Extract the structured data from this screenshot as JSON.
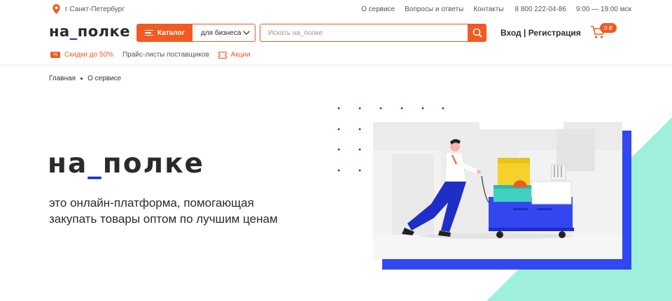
{
  "topbar": {
    "city": "г Санкт-Петербург",
    "links": [
      "О сервисе",
      "Вопросы и ответы",
      "Контакты"
    ],
    "phone": "8 800 222-04-86",
    "hours": "9:00 — 19:00 мск"
  },
  "header": {
    "logo_left": "на",
    "logo_underscore": "_",
    "logo_right": "полке",
    "catalog_label": "Каталог",
    "business_select": "для бизнеса",
    "search_placeholder": "Искать на_полке",
    "login_label": "Вход | Регистрация",
    "cart_total": "0 ₽"
  },
  "subnav": {
    "discount_badge": "%",
    "discount_label": "Скидки до 50%",
    "pricelists_label": "Прайс-листы поставщиков",
    "promos_label": "Акции"
  },
  "breadcrumb": [
    "Главная",
    "О сервисе"
  ],
  "hero": {
    "logo_left": "на",
    "logo_underscore": "_",
    "logo_right": "полке",
    "tagline_line1": "это онлайн-платформа, помогающая",
    "tagline_line2": "закупать товары оптом по лучшим ценам"
  },
  "colors": {
    "accent": "#f15a22",
    "brand_blue": "#1e2ec6",
    "mint": "#9ef0dc"
  },
  "icons": [
    "location-pin-icon",
    "burger-menu-icon",
    "chevron-down-icon",
    "search-icon",
    "cart-icon",
    "percent-badge-icon",
    "ticket-icon"
  ]
}
